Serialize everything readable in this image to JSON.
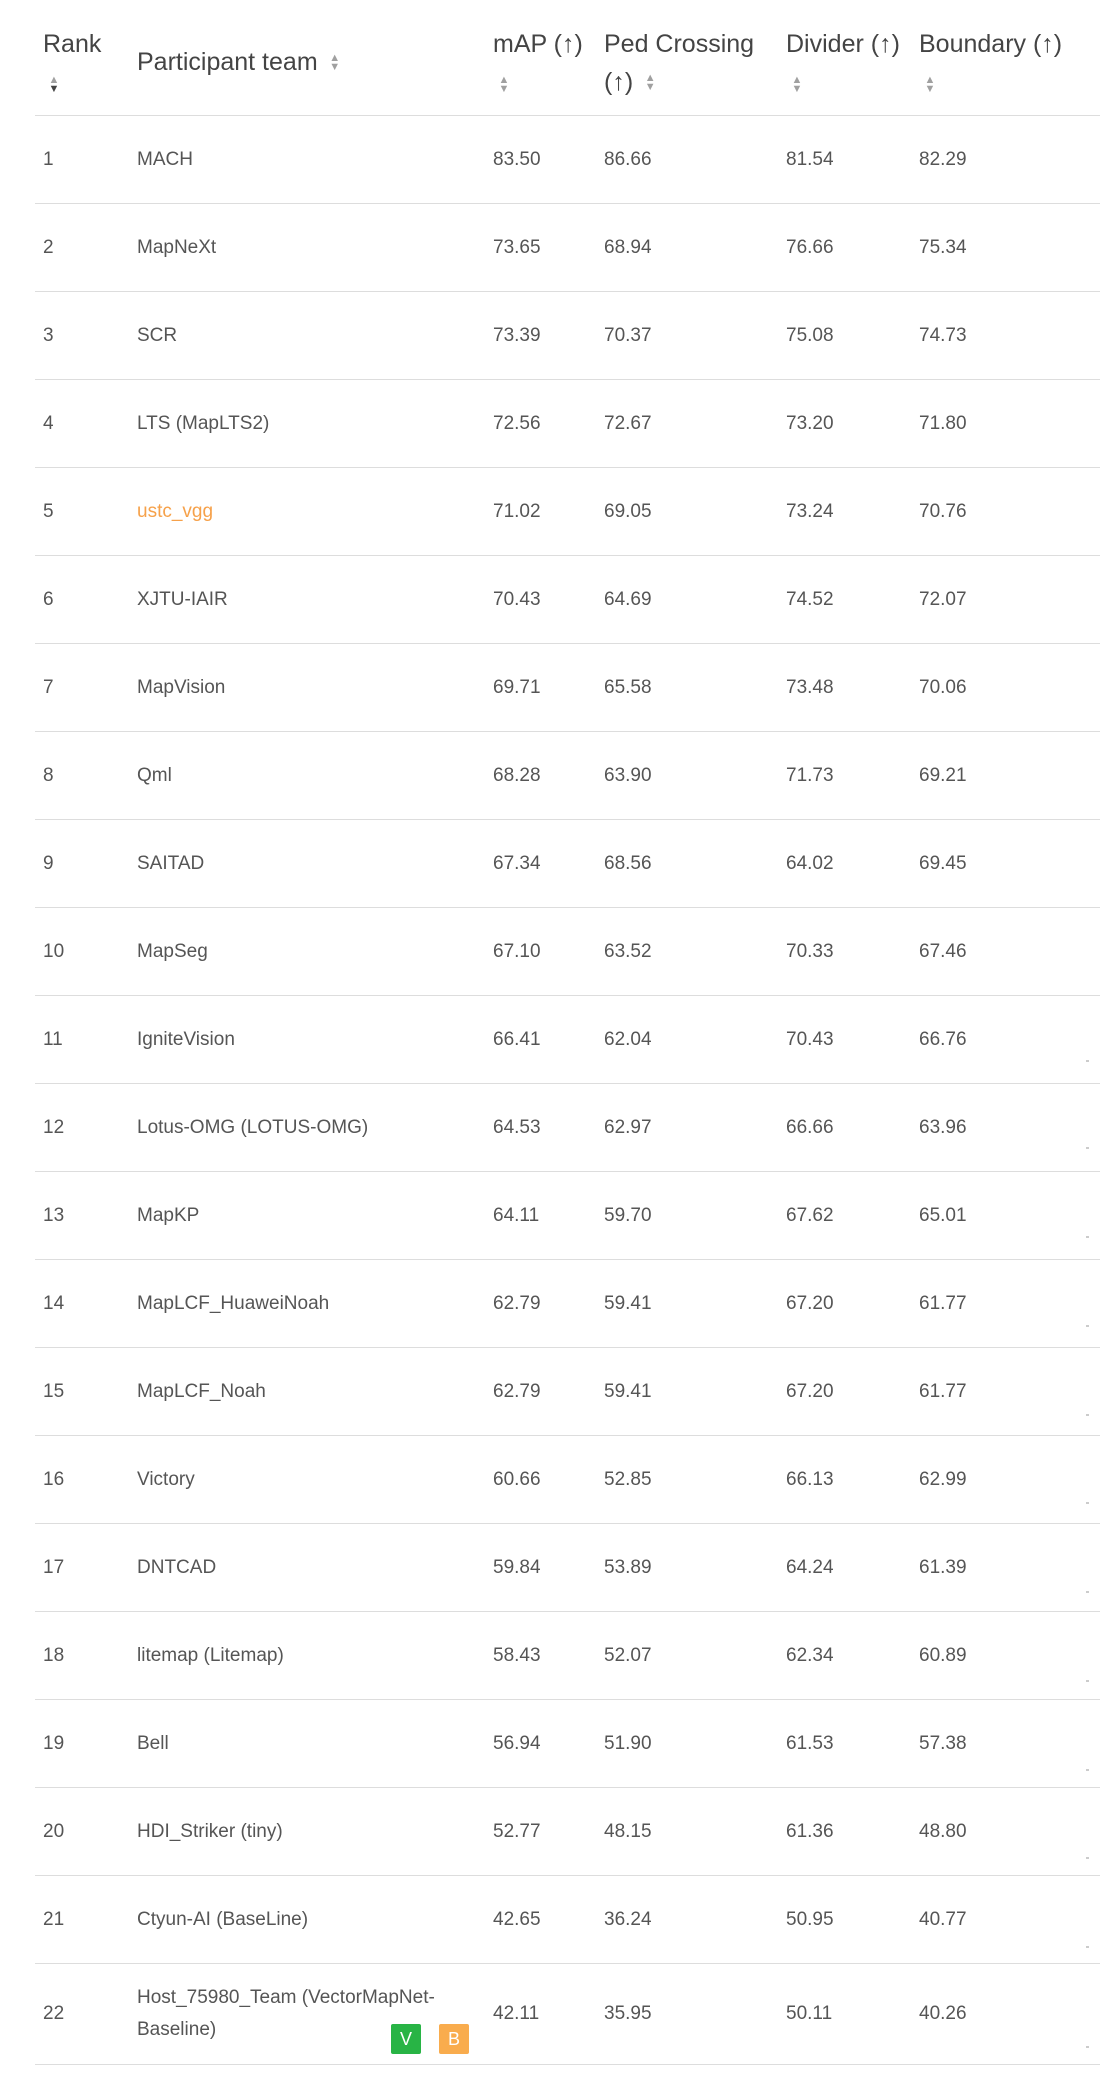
{
  "headers": {
    "rank": "Rank",
    "team": "Participant team",
    "map": "mAP (↑)",
    "ped": "Ped Crossing (↑)",
    "divider": "Divider (↑)",
    "boundary": "Boundary (↑)"
  },
  "icons": {
    "sort": "sort-icon"
  },
  "colors": {
    "highlight_team": "#f6a14a",
    "badge_v": "#28b445",
    "badge_b": "#f9ac4d",
    "border": "#dddddd"
  },
  "rows": [
    {
      "rank": "1",
      "team": "MACH",
      "map": "83.50",
      "ped": "86.66",
      "divider": "81.54",
      "boundary": "82.29"
    },
    {
      "rank": "2",
      "team": "MapNeXt",
      "map": "73.65",
      "ped": "68.94",
      "divider": "76.66",
      "boundary": "75.34"
    },
    {
      "rank": "3",
      "team": "SCR",
      "map": "73.39",
      "ped": "70.37",
      "divider": "75.08",
      "boundary": "74.73"
    },
    {
      "rank": "4",
      "team": "LTS (MapLTS2)",
      "map": "72.56",
      "ped": "72.67",
      "divider": "73.20",
      "boundary": "71.80"
    },
    {
      "rank": "5",
      "team": "ustc_vgg",
      "map": "71.02",
      "ped": "69.05",
      "divider": "73.24",
      "boundary": "70.76",
      "highlight": true
    },
    {
      "rank": "6",
      "team": "XJTU-IAIR",
      "map": "70.43",
      "ped": "64.69",
      "divider": "74.52",
      "boundary": "72.07"
    },
    {
      "rank": "7",
      "team": "MapVision",
      "map": "69.71",
      "ped": "65.58",
      "divider": "73.48",
      "boundary": "70.06"
    },
    {
      "rank": "8",
      "team": "Qml",
      "map": "68.28",
      "ped": "63.90",
      "divider": "71.73",
      "boundary": "69.21"
    },
    {
      "rank": "9",
      "team": "SAITAD",
      "map": "67.34",
      "ped": "68.56",
      "divider": "64.02",
      "boundary": "69.45"
    },
    {
      "rank": "10",
      "team": "MapSeg",
      "map": "67.10",
      "ped": "63.52",
      "divider": "70.33",
      "boundary": "67.46"
    },
    {
      "rank": "11",
      "team": "IgniteVision",
      "map": "66.41",
      "ped": "62.04",
      "divider": "70.43",
      "boundary": "66.76"
    },
    {
      "rank": "12",
      "team": "Lotus-OMG (LOTUS-OMG)",
      "map": "64.53",
      "ped": "62.97",
      "divider": "66.66",
      "boundary": "63.96"
    },
    {
      "rank": "13",
      "team": "MapKP",
      "map": "64.11",
      "ped": "59.70",
      "divider": "67.62",
      "boundary": "65.01"
    },
    {
      "rank": "14",
      "team": "MapLCF_HuaweiNoah",
      "map": "62.79",
      "ped": "59.41",
      "divider": "67.20",
      "boundary": "61.77"
    },
    {
      "rank": "15",
      "team": "MapLCF_Noah",
      "map": "62.79",
      "ped": "59.41",
      "divider": "67.20",
      "boundary": "61.77"
    },
    {
      "rank": "16",
      "team": "Victory",
      "map": "60.66",
      "ped": "52.85",
      "divider": "66.13",
      "boundary": "62.99"
    },
    {
      "rank": "17",
      "team": "DNTCAD",
      "map": "59.84",
      "ped": "53.89",
      "divider": "64.24",
      "boundary": "61.39"
    },
    {
      "rank": "18",
      "team": "litemap (Litemap)",
      "map": "58.43",
      "ped": "52.07",
      "divider": "62.34",
      "boundary": "60.89"
    },
    {
      "rank": "19",
      "team": "Bell",
      "map": "56.94",
      "ped": "51.90",
      "divider": "61.53",
      "boundary": "57.38"
    },
    {
      "rank": "20",
      "team": "HDI_Striker (tiny)",
      "map": "52.77",
      "ped": "48.15",
      "divider": "61.36",
      "boundary": "48.80"
    },
    {
      "rank": "21",
      "team": "Ctyun-AI (BaseLine)",
      "map": "42.65",
      "ped": "36.24",
      "divider": "50.95",
      "boundary": "40.77"
    },
    {
      "rank": "22",
      "team": "Host_75980_Team (VectorMapNet-Baseline)",
      "map": "42.11",
      "ped": "35.95",
      "divider": "50.11",
      "boundary": "40.26",
      "badges": [
        "V",
        "B"
      ]
    }
  ]
}
